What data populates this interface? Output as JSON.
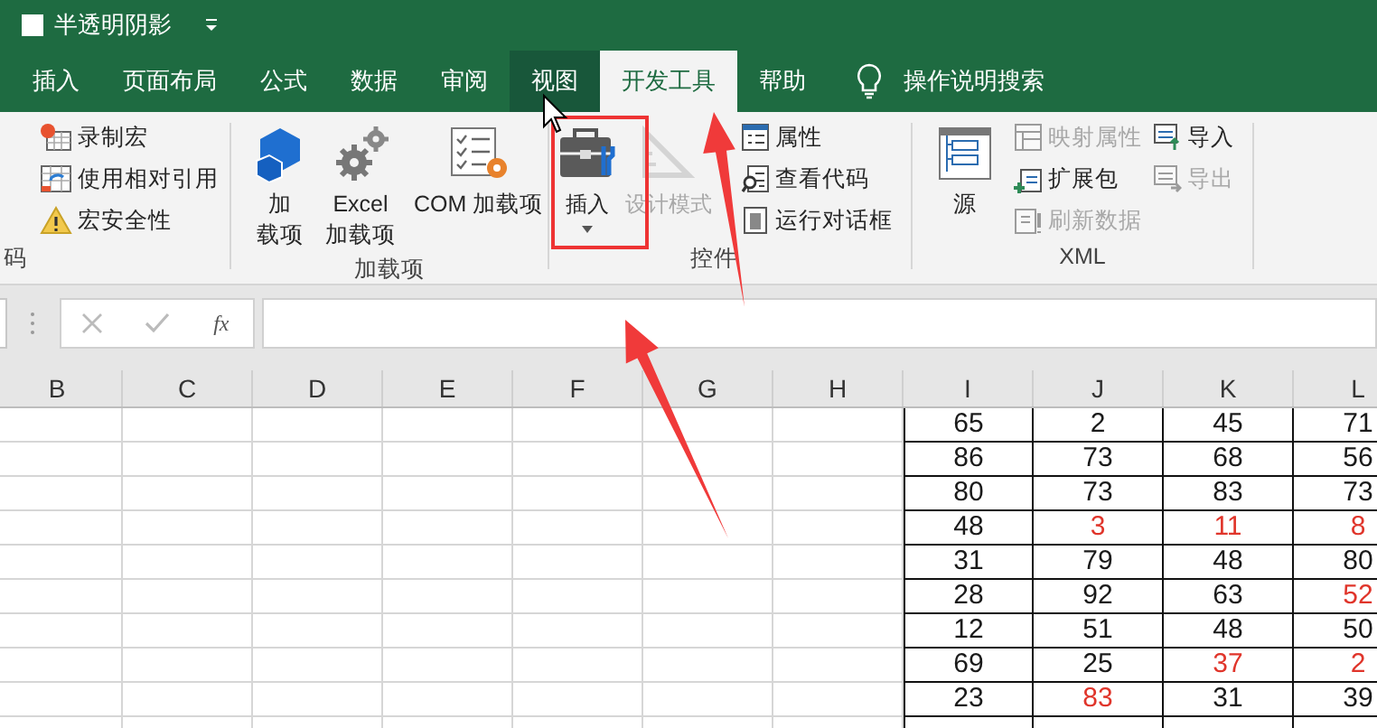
{
  "title_bar": {
    "checked": false,
    "title": "半透明阴影"
  },
  "tabs": [
    {
      "label": "插入",
      "selected": false,
      "hovered": false
    },
    {
      "label": "页面布局",
      "selected": false,
      "hovered": false
    },
    {
      "label": "公式",
      "selected": false,
      "hovered": false
    },
    {
      "label": "数据",
      "selected": false,
      "hovered": false
    },
    {
      "label": "审阅",
      "selected": false,
      "hovered": false
    },
    {
      "label": "视图",
      "selected": false,
      "hovered": true
    },
    {
      "label": "开发工具",
      "selected": true,
      "hovered": false
    },
    {
      "label": "帮助",
      "selected": false,
      "hovered": false
    }
  ],
  "tell_me": {
    "label": "操作说明搜索"
  },
  "ribbon": {
    "code": {
      "label": "码",
      "items": [
        {
          "label": "录制宏",
          "disabled": false
        },
        {
          "label": "使用相对引用",
          "disabled": false
        },
        {
          "label": "宏安全性",
          "disabled": false
        }
      ]
    },
    "addins": {
      "label": "加载项",
      "buttons": [
        {
          "lines": [
            "加",
            "载项"
          ],
          "disabled": false
        },
        {
          "lines": [
            "Excel",
            "加载项"
          ],
          "disabled": false
        },
        {
          "lines": [
            "COM 加载项"
          ],
          "disabled": false
        }
      ]
    },
    "controls": {
      "label": "控件",
      "large": [
        {
          "label": "插入",
          "disabled": false
        },
        {
          "label": "设计模式",
          "disabled": true
        }
      ],
      "small": [
        {
          "label": "属性",
          "disabled": false
        },
        {
          "label": "查看代码",
          "disabled": false
        },
        {
          "label": "运行对话框",
          "disabled": false
        }
      ]
    },
    "xml": {
      "label": "XML",
      "large": [
        {
          "label": "源",
          "disabled": false
        }
      ],
      "small": [
        {
          "label": "映射属性",
          "disabled": true
        },
        {
          "label": "扩展包",
          "disabled": false
        },
        {
          "label": "刷新数据",
          "disabled": true
        },
        {
          "label": "导入",
          "disabled": false
        },
        {
          "label": "导出",
          "disabled": true
        }
      ]
    }
  },
  "formula_bar": {
    "insert_function": "fx"
  },
  "columns": [
    "B",
    "C",
    "D",
    "E",
    "F",
    "G",
    "H",
    "I",
    "J",
    "K",
    "L"
  ],
  "rows": [
    [
      {
        "text": "65",
        "color": "#1a1a1a"
      },
      {
        "text": "2",
        "color": "#1a1a1a"
      },
      {
        "text": "45",
        "color": "#1a1a1a"
      },
      {
        "text": "71",
        "color": "#1a1a1a"
      }
    ],
    [
      {
        "text": "86",
        "color": "#1a1a1a"
      },
      {
        "text": "73",
        "color": "#1a1a1a"
      },
      {
        "text": "68",
        "color": "#1a1a1a"
      },
      {
        "text": "56",
        "color": "#1a1a1a"
      }
    ],
    [
      {
        "text": "80",
        "color": "#1a1a1a"
      },
      {
        "text": "73",
        "color": "#1a1a1a"
      },
      {
        "text": "83",
        "color": "#1a1a1a"
      },
      {
        "text": "73",
        "color": "#1a1a1a"
      }
    ],
    [
      {
        "text": "48",
        "color": "#1a1a1a"
      },
      {
        "text": "3",
        "color": "#e0352b"
      },
      {
        "text": "11",
        "color": "#e0352b"
      },
      {
        "text": "8",
        "color": "#e0352b"
      }
    ],
    [
      {
        "text": "31",
        "color": "#1a1a1a"
      },
      {
        "text": "79",
        "color": "#1a1a1a"
      },
      {
        "text": "48",
        "color": "#1a1a1a"
      },
      {
        "text": "80",
        "color": "#1a1a1a"
      }
    ],
    [
      {
        "text": "28",
        "color": "#1a1a1a"
      },
      {
        "text": "92",
        "color": "#1a1a1a"
      },
      {
        "text": "63",
        "color": "#1a1a1a"
      },
      {
        "text": "52",
        "color": "#e0352b"
      }
    ],
    [
      {
        "text": "12",
        "color": "#1a1a1a"
      },
      {
        "text": "51",
        "color": "#1a1a1a"
      },
      {
        "text": "48",
        "color": "#1a1a1a"
      },
      {
        "text": "50",
        "color": "#1a1a1a"
      }
    ],
    [
      {
        "text": "69",
        "color": "#1a1a1a"
      },
      {
        "text": "25",
        "color": "#1a1a1a"
      },
      {
        "text": "37",
        "color": "#e0352b"
      },
      {
        "text": "2",
        "color": "#e0352b"
      }
    ],
    [
      {
        "text": "23",
        "color": "#1a1a1a"
      },
      {
        "text": "83",
        "color": "#e0352b"
      },
      {
        "text": "31",
        "color": "#1a1a1a"
      },
      {
        "text": "39",
        "color": "#1a1a1a"
      }
    ]
  ]
}
